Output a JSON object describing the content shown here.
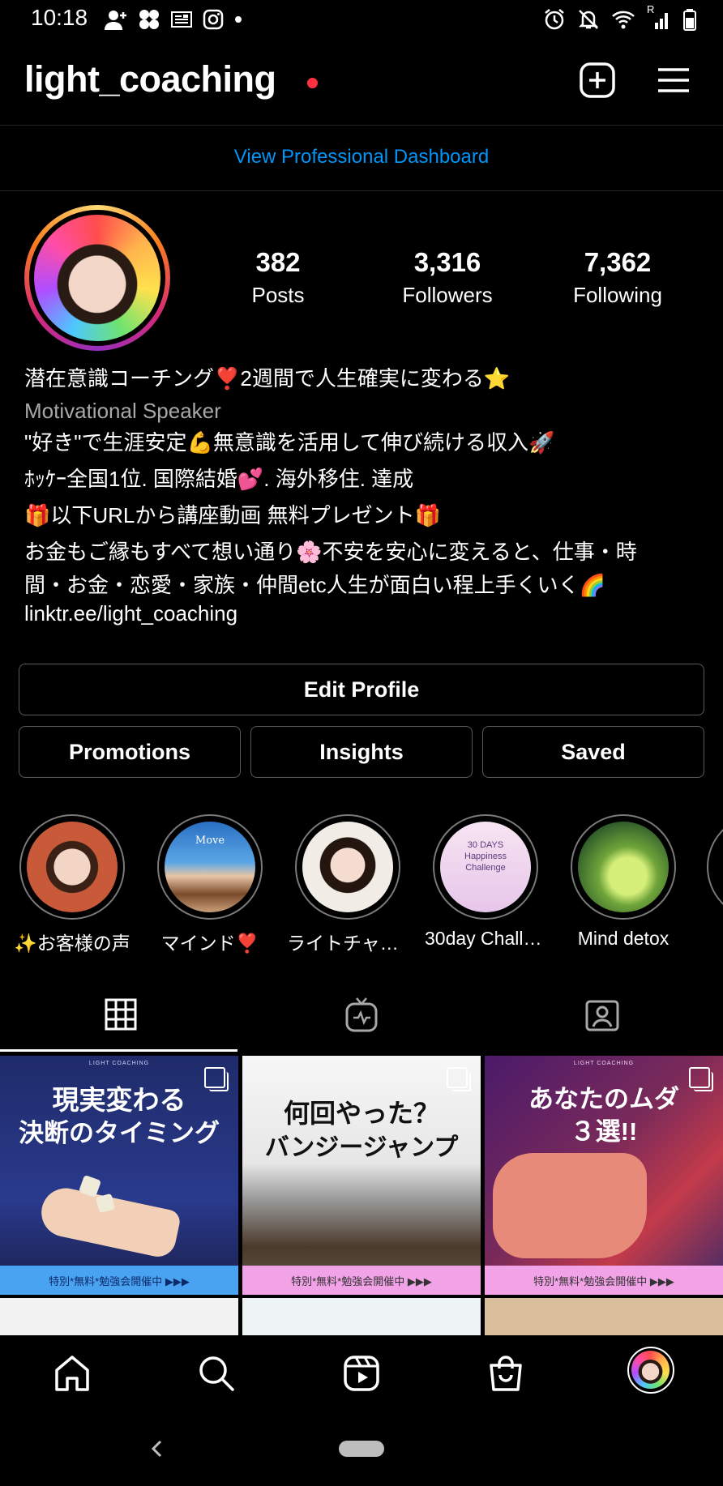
{
  "status_bar": {
    "time": "10:18",
    "left_icons": [
      "add-person-icon",
      "pinwheel-icon",
      "news-icon",
      "instagram-icon",
      "dot-icon"
    ],
    "right_icons": [
      "alarm-icon",
      "mute-icon",
      "wifi-icon",
      "signal-icon",
      "battery-icon"
    ],
    "signal_roaming": "R"
  },
  "header": {
    "username": "light_coaching",
    "create_icon": "plus-square-icon",
    "menu_icon": "hamburger-menu-icon"
  },
  "dashboard_link": "View Professional Dashboard",
  "profile": {
    "stats": [
      {
        "value": "382",
        "label": "Posts"
      },
      {
        "value": "3,316",
        "label": "Followers"
      },
      {
        "value": "7,362",
        "label": "Following"
      }
    ],
    "bio_lines": [
      "潜在意識コーチング❣️2週間で人生確実に変わる⭐",
      "\"好き\"で生涯安定💪無意識を活用して伸び続ける収入🚀",
      "ﾎｯｹｰ全国1位. 国際結婚💕. 海外移住. 達成",
      "🎁以下URLから講座動画 無料プレゼント🎁",
      "お金もご縁もすべて想い通り🌸不安を安心に変えると、仕事・時",
      "間・お金・恋愛・家族・仲間etc人生が面白い程上手くいく🌈"
    ],
    "category": "Motivational Speaker",
    "link": "linktr.ee/light_coaching"
  },
  "buttons": {
    "edit_profile": "Edit Profile",
    "promotions": "Promotions",
    "insights": "Insights",
    "saved": "Saved"
  },
  "highlights": [
    {
      "label": "✨お客様の声",
      "inner_text": ""
    },
    {
      "label": "マインド❣️",
      "inner_text": "Move"
    },
    {
      "label": "ライトチャット",
      "inner_text": ""
    },
    {
      "label": "30day Challen...",
      "inner_text": "30 DAYS Happiness Challenge"
    },
    {
      "label": "Mind detox",
      "inner_text": ""
    }
  ],
  "tabs": [
    {
      "icon": "grid-icon",
      "active": true
    },
    {
      "icon": "igtv-icon",
      "active": false
    },
    {
      "icon": "tagged-icon",
      "active": false
    }
  ],
  "posts": [
    {
      "title_lines": [
        "現実変わる",
        "決断のタイミング"
      ],
      "brand": "LIGHT COACHING",
      "footer": "特別*無料*勉強会開催中 ▶▶▶",
      "footer_color": "#4aa3f0"
    },
    {
      "title_lines": [
        "何回やった？",
        "バンジージャンプ"
      ],
      "brand": "",
      "footer": "特別*無料*勉強会開催中 ▶▶▶",
      "footer_color": "#f2a2e6"
    },
    {
      "title_lines": [
        "あなたのムダ",
        "３選!!"
      ],
      "brand": "LIGHT COACHING",
      "footer": "特別*無料*勉強会開催中 ▶▶▶",
      "footer_color": "#f2a2e6"
    }
  ],
  "bottom_nav": [
    "home-icon",
    "search-icon",
    "reels-icon",
    "shop-icon",
    "profile-avatar"
  ],
  "colors": {
    "link": "#0095f6",
    "background": "#000000",
    "record_dot": "#ff3040"
  }
}
